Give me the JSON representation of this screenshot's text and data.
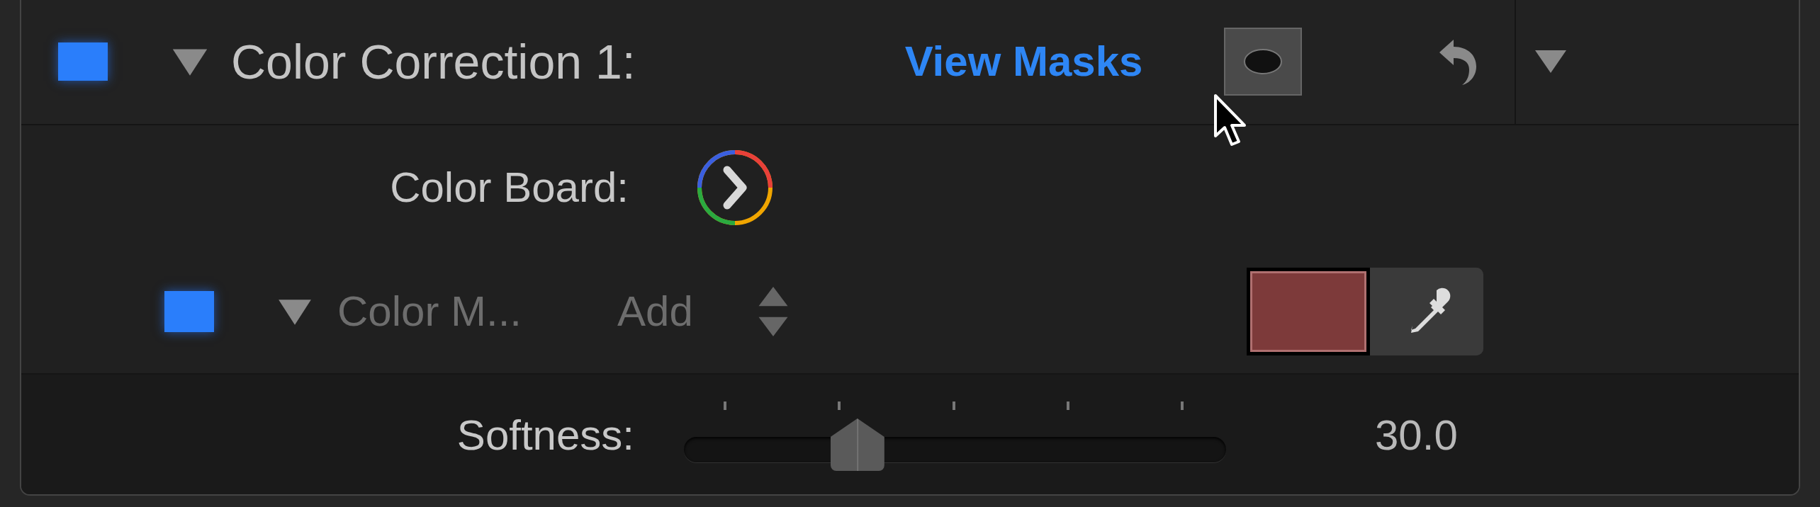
{
  "header": {
    "enabled": true,
    "expanded": true,
    "title": "Color Correction 1:",
    "link": "View Masks"
  },
  "color_board": {
    "label": "Color Board:"
  },
  "mask": {
    "enabled": true,
    "expanded": true,
    "name": "Color M...",
    "mode": "Add",
    "color": "#7d3a3a"
  },
  "softness": {
    "label": "Softness:",
    "level": 0.32,
    "reading": "30.0"
  }
}
